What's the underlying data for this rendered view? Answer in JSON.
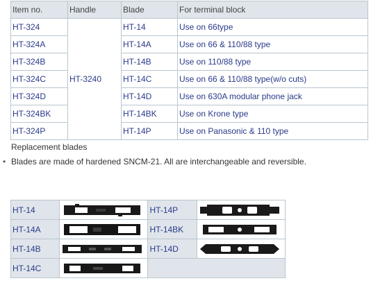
{
  "spec_table": {
    "headers": [
      "Item no.",
      "Handle",
      "Blade",
      "For terminal block"
    ],
    "handle": "HT-3240",
    "rows": [
      {
        "item": "HT-324",
        "blade": "HT-14",
        "use": "Use on 66type"
      },
      {
        "item": "HT-324A",
        "blade": "HT-14A",
        "use": "Use on 66 & 110/88 type"
      },
      {
        "item": "HT-324B",
        "blade": "HT-14B",
        "use": "Use on 110/88 type"
      },
      {
        "item": "HT-324C",
        "blade": "HT-14C",
        "use": "Use on 66 & 110/88 type(w/o cuts)"
      },
      {
        "item": "HT-324D",
        "blade": "HT-14D",
        "use": "Use on 630A modular phone jack"
      },
      {
        "item": "HT-324BK",
        "blade": "HT-14BK",
        "use": "Use on Krone type"
      },
      {
        "item": "HT-324P",
        "blade": "HT-14P",
        "use": "Use on Panasonic & 110 type"
      }
    ]
  },
  "notes": {
    "replacement": "Replacement blades",
    "bullet": "Blades are made of hardened SNCM-21. All are interchangeable and reversible."
  },
  "blade_table": {
    "left": [
      "HT-14",
      "HT-14A",
      "HT-14B",
      "HT-14C"
    ],
    "right": [
      "HT-14P",
      "HT-14BK",
      "HT-14D"
    ]
  }
}
